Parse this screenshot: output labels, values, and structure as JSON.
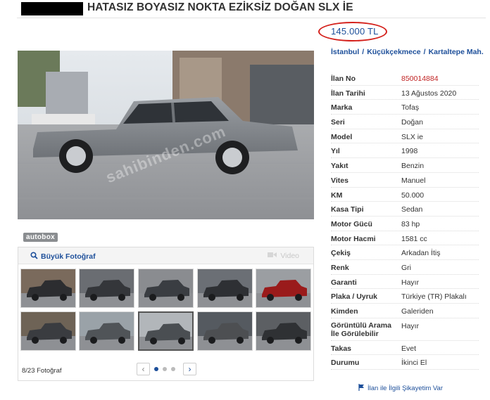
{
  "listing": {
    "title": "HATASIZ BOYASIZ NOKTA EZİKSİZ DOĞAN SLX İE",
    "price": "145.000 TL",
    "location": [
      "İstanbul",
      "Küçükçekmece",
      "Kartaltepe Mah."
    ]
  },
  "photo": {
    "watermark": "sahibinden.com",
    "badge": "autobox"
  },
  "gallery": {
    "big_photo_label": "Büyük Fotoğraf",
    "video_label": "Video",
    "count_label": "8/23 Fotoğraf",
    "prev": "‹",
    "next": "›"
  },
  "details": [
    {
      "k": "İlan No",
      "v": "850014884"
    },
    {
      "k": "İlan Tarihi",
      "v": "13 Ağustos 2020"
    },
    {
      "k": "Marka",
      "v": "Tofaş"
    },
    {
      "k": "Seri",
      "v": "Doğan"
    },
    {
      "k": "Model",
      "v": "SLX ie"
    },
    {
      "k": "Yıl",
      "v": "1998"
    },
    {
      "k": "Yakıt",
      "v": "Benzin"
    },
    {
      "k": "Vites",
      "v": "Manuel"
    },
    {
      "k": "KM",
      "v": "50.000"
    },
    {
      "k": "Kasa Tipi",
      "v": "Sedan"
    },
    {
      "k": "Motor Gücü",
      "v": "83 hp"
    },
    {
      "k": "Motor Hacmi",
      "v": "1581 cc"
    },
    {
      "k": "Çekiş",
      "v": "Arkadan İtiş"
    },
    {
      "k": "Renk",
      "v": "Gri"
    },
    {
      "k": "Garanti",
      "v": "Hayır"
    },
    {
      "k": "Plaka / Uyruk",
      "v": "Türkiye (TR) Plakalı"
    },
    {
      "k": "Kimden",
      "v": "Galeriden"
    },
    {
      "k": "Görüntülü Arama İle Görülebilir",
      "v": "Hayır"
    },
    {
      "k": "Takas",
      "v": "Evet"
    },
    {
      "k": "Durumu",
      "v": "İkinci El"
    }
  ],
  "complaint_label": "İlan ile İlgili Şikayetim Var",
  "colors": {
    "link": "#1d4f9a",
    "price_circle": "#d4201b",
    "listing_no": "#c02424"
  }
}
